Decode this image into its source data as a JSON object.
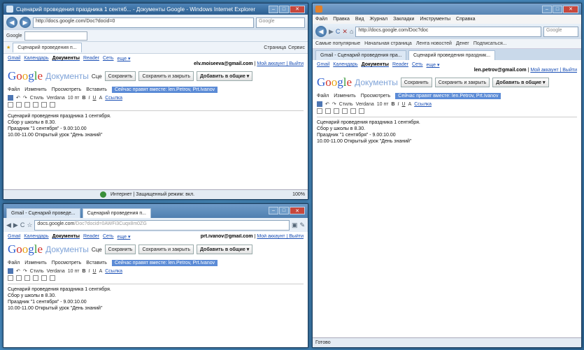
{
  "ie_window": {
    "title": "Сценарий проведения праздника 1 сентяб... - Документы Google - Windows Internet Explorer",
    "address": "http://docs.google.com/Doc?docid=0",
    "search_placeholder": "Google",
    "toolbar_label": "Google",
    "tab": "Сценарий проведения п...",
    "toolbar_items": [
      "Страница",
      "Сервис"
    ],
    "status_text": "Интернет | Защищенный режим: вкл.",
    "zoom": "100%"
  },
  "firefox_window": {
    "menu": [
      "Файл",
      "Правка",
      "Вид",
      "Журнал",
      "Закладки",
      "Инструменты",
      "Справка"
    ],
    "address": "http://docs.google.com/Doc?doc",
    "search_placeholder": "Google",
    "bookmarks": [
      "Самые популярные",
      "Начальная страница",
      "Лента новостей",
      "Денег",
      "Подписаться..."
    ],
    "tabs": [
      "Gmail - Сценарий проведения пра...",
      "Сценарий проведения праздник..."
    ],
    "status_text": "Готово"
  },
  "chrome_window": {
    "tabs": [
      "Gmail - Сценарий проведе...",
      "Сценарий проведения п..."
    ],
    "address_host": "docs.google.com",
    "address_path": "/Doc?docid=0AWFi3Cuqx8m0ZG"
  },
  "google_nav": {
    "links": [
      "Gmail",
      "Календарь"
    ],
    "current": "Документы",
    "links2": [
      "Reader",
      "Сеть",
      "еще ▾"
    ]
  },
  "users": {
    "ie": "elv.moiseeva@gmail.com",
    "firefox": "len.petrov@gmail.com",
    "chrome": "prt.ivanov@gmail.com",
    "links": "Мой аккаунт | Выйти"
  },
  "docs_header": {
    "logo": "Google",
    "product": "Документы",
    "doc_name_short": "Сце",
    "save": "Сохранить",
    "save_close": "Сохранить и закрыть",
    "share": "Добавить в общие ▾"
  },
  "docs_menu": [
    "Файл",
    "Изменить",
    "Просмотреть",
    "Вставить"
  ],
  "saved_notice": "Сейчас правят вместе: len.Petrov, Prt.Ivanov",
  "format_toolbar": {
    "style": "Стиль",
    "font": "Verdana",
    "size": "10 пт",
    "link": "Ссылка"
  },
  "document_lines": [
    "Сценарий проведения праздника 1 сентября.",
    "Сбор у школы в 8.30.",
    "Праздник \"1 сентября\" - 9.00:10.00",
    "10.00-11.00 Открытый урок \"День знаний\""
  ]
}
